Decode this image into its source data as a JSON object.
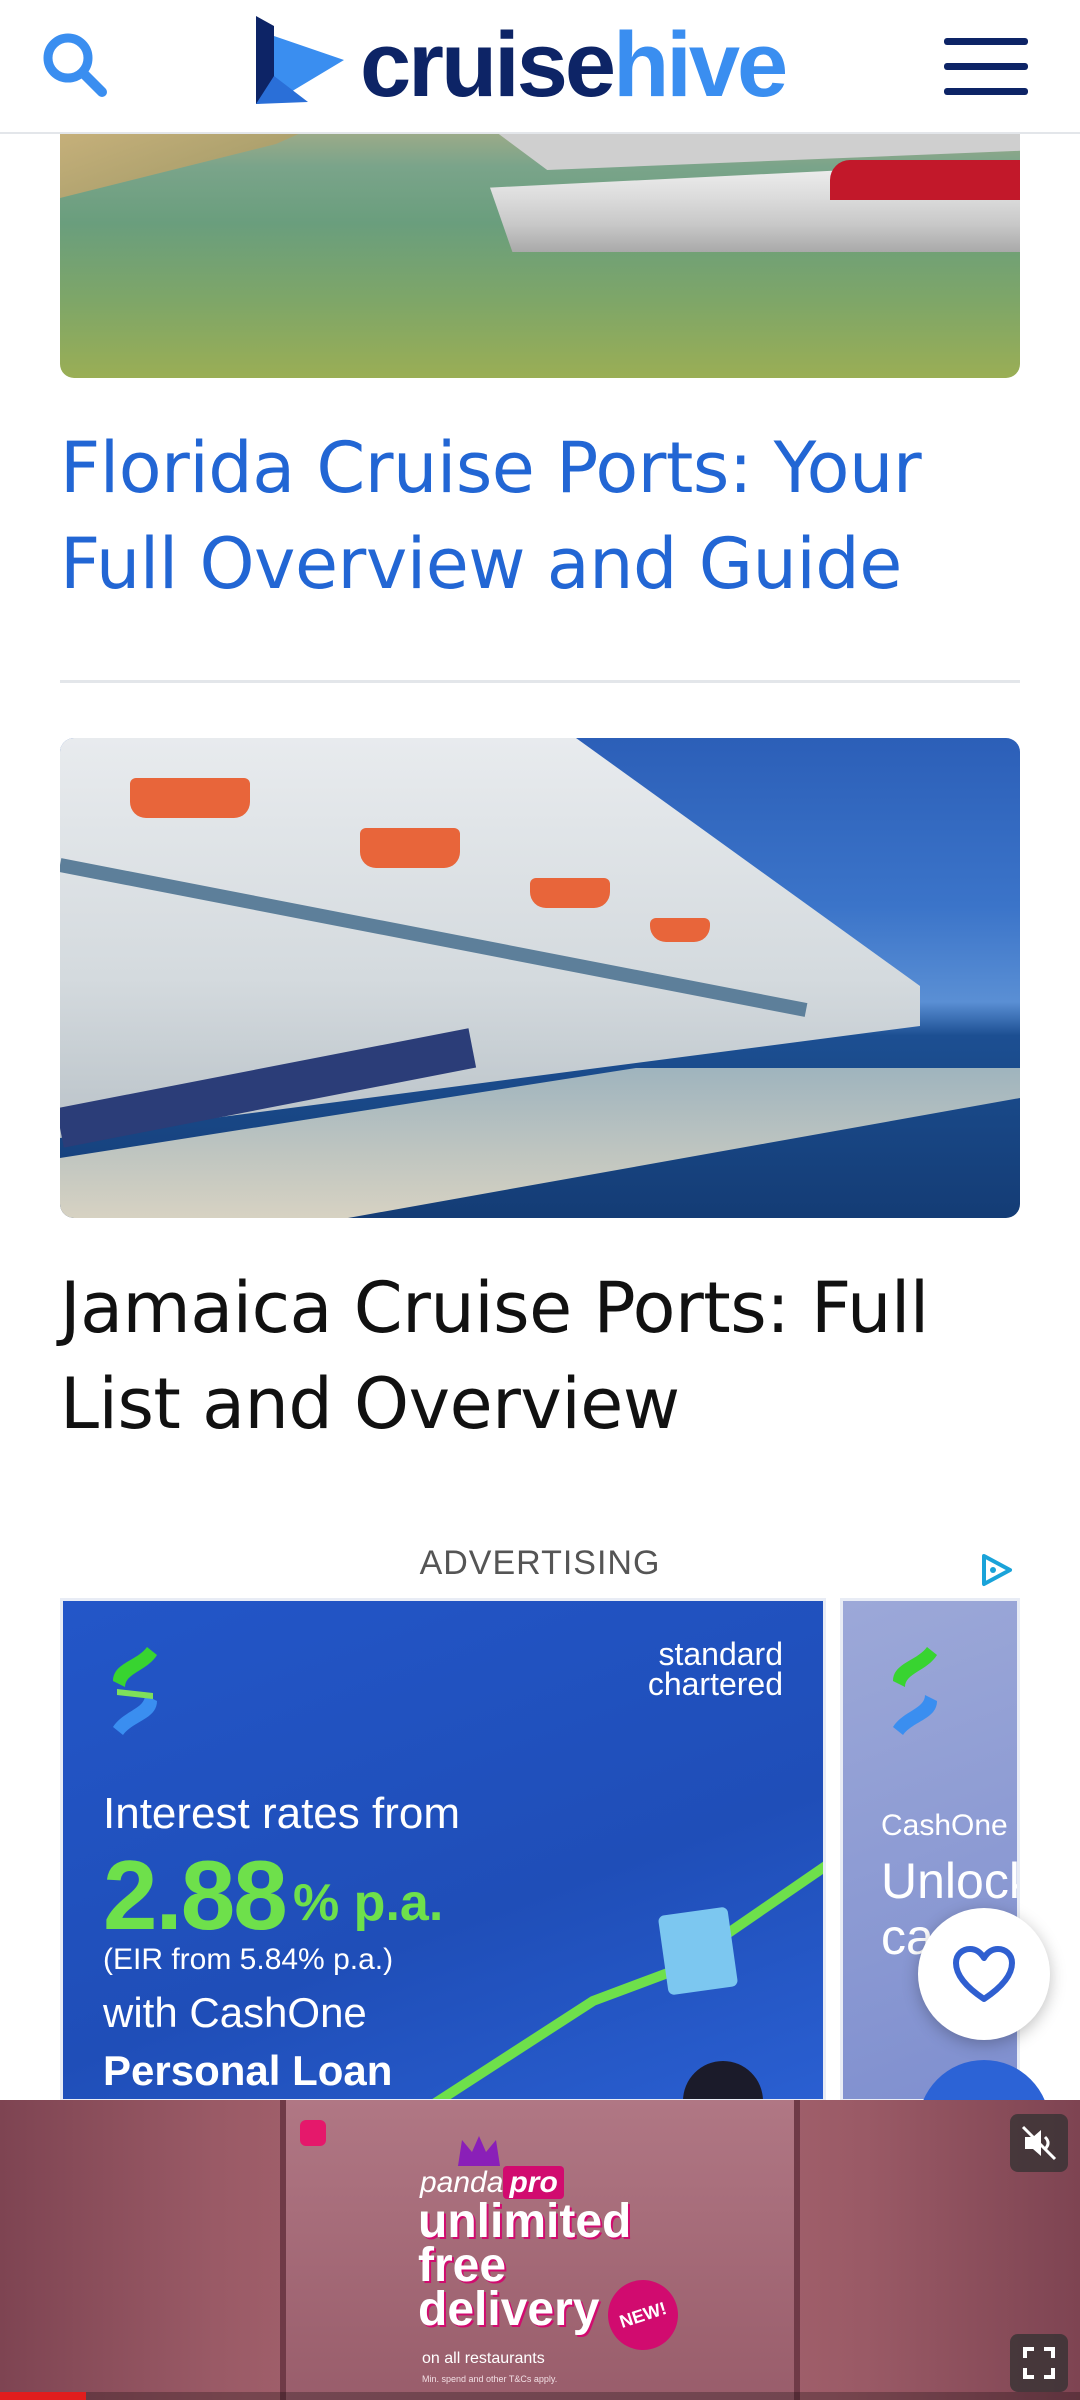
{
  "header": {
    "logo_part1": "cruise",
    "logo_part2": "hive",
    "icons": {
      "search": "search-icon",
      "menu": "hamburger-menu-icon",
      "logo": "cruisehive-logo-mark"
    },
    "colors": {
      "navy": "#0d2466",
      "blue": "#3a8ef0"
    }
  },
  "articles": [
    {
      "title": "Florida Cruise Ports: Your Full Overview and Guide",
      "image": "cruise-ship-at-florida-port-photo",
      "title_color": "#2266d4"
    },
    {
      "title": "Jamaica Cruise Ports: Full List and Overview",
      "image": "cruise-ship-docked-at-jamaica-pier-photo",
      "title_color": "#111111"
    }
  ],
  "ad": {
    "label": "ADVERTISING",
    "brand": "standard chartered",
    "line1": "Interest rates from",
    "rate": "2.88",
    "rate_unit": "% p.a.",
    "eir": "(EIR from 5.84% p.a.)",
    "line2": "with CashOne",
    "line3": "Personal Loan",
    "side_label": "CashOne",
    "side_text": "Unlock ca m"
  },
  "floating": {
    "favorite_icon": "heart-icon"
  },
  "video_ad": {
    "brand": "panda",
    "brand_pro": "pro",
    "headline_1": "unlimited",
    "headline_2": "free",
    "headline_3": "delivery",
    "badge": "NEW!",
    "sub": "on all restaurants",
    "fine_print": "Min. spend and other T&Cs apply.",
    "progress": 0.08,
    "accent": "#d10b6f"
  }
}
